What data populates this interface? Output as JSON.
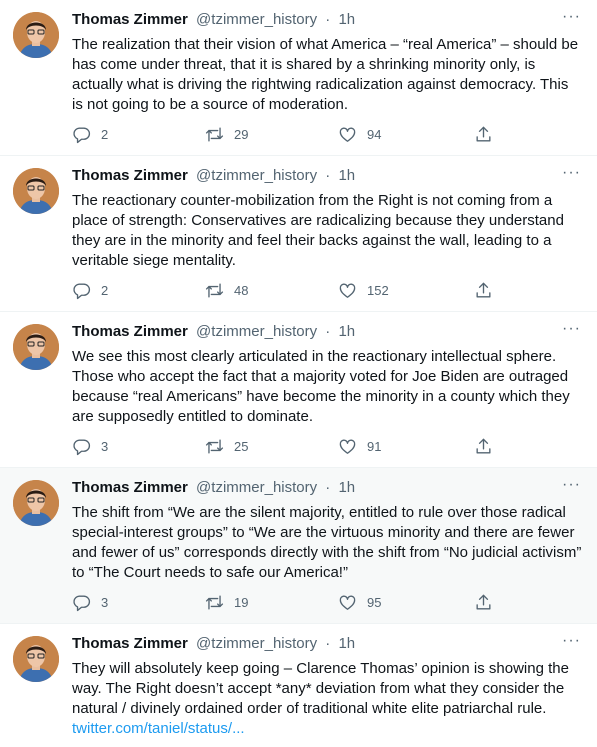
{
  "author": {
    "name": "Thomas Zimmer",
    "handle": "@tzimmer_history",
    "separator": "·",
    "time": "1h"
  },
  "more_label": "···",
  "tweets": [
    {
      "text": "The realization that their vision of what America – “real America” – should be has come under threat, that it is shared by a shrinking minority only, is actually what is driving the rightwing radicalization against democracy. This is not going to be a source of moderation.",
      "replies": "2",
      "retweets": "29",
      "likes": "94"
    },
    {
      "text": "The reactionary counter-mobilization from the Right is not coming from a place of strength: Conservatives are radicalizing because they understand they are in the minority and feel their backs against the wall, leading to a veritable siege mentality.",
      "replies": "2",
      "retweets": "48",
      "likes": "152"
    },
    {
      "text": "We see this most clearly articulated in the reactionary intellectual sphere. Those who accept the fact that a majority voted for Joe Biden are outraged because “real Americans” have become the minority in a county which they are supposedly entitled to dominate.",
      "replies": "3",
      "retweets": "25",
      "likes": "91"
    },
    {
      "text": "The shift from “We are the silent majority, entitled to rule over those radical special-interest groups” to “We are the virtuous minority and there are fewer and fewer of us” corresponds directly with the shift from “No judicial activism” to “The Court needs to safe our America!”",
      "replies": "3",
      "retweets": "19",
      "likes": "95"
    },
    {
      "text": "They will absolutely keep going – Clarence Thomas’ opinion is showing the way. The Right doesn’t accept *any* deviation from what they consider the natural / divinely ordained order of traditional white elite patriarchal rule.",
      "link": "twitter.com/taniel/status/..."
    }
  ],
  "icons": {
    "reply": "reply-icon",
    "retweet": "retweet-icon",
    "like": "heart-icon",
    "share": "share-icon",
    "more": "more-dots-icon"
  },
  "colors": {
    "text": "#0f1419",
    "secondary": "#536471",
    "link": "#1d9bf0",
    "highlight_bg": "#f7f9f9",
    "divider": "#eff3f4"
  }
}
